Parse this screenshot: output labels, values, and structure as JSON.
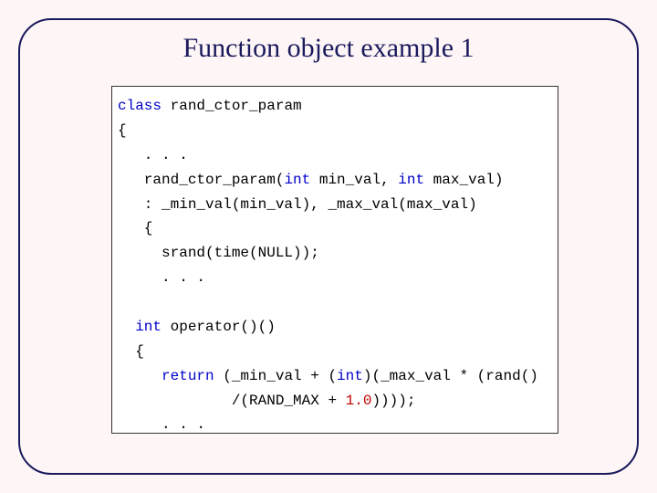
{
  "title": "Function object example 1",
  "code": {
    "l0a": "class",
    "l0b": " rand_ctor_param",
    "l1": "{",
    "l2": "   . . .",
    "l3a": "   rand_ctor_param(",
    "l3b": "int",
    "l3c": " min_val, ",
    "l3d": "int",
    "l3e": " max_val)",
    "l4": "   : _min_val(min_val), _max_val(max_val)",
    "l5": "   {",
    "l6": "     srand(time(NULL));",
    "l7": "     . . .",
    "l8": " ",
    "l9a": "  int",
    "l9b": " operator()()",
    "l10": "  {",
    "l11a": "     return",
    "l11b": " (_min_val + (",
    "l11c": "int",
    "l11d": ")(_max_val * (rand()",
    "l12a": "             /(RAND_MAX + ",
    "l12b": "1.0",
    "l12c": "))));",
    "l13": "     . . ."
  }
}
